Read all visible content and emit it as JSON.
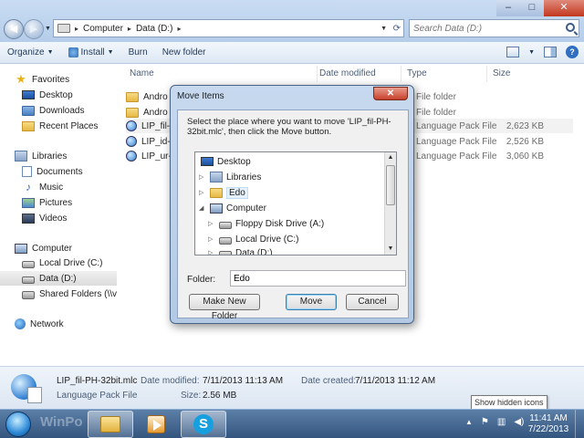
{
  "window": {
    "address_crumbs": [
      "Computer",
      "Data (D:)"
    ],
    "search_placeholder": "Search Data (D:)",
    "min_label": "–",
    "max_label": "□",
    "close_label": "✕"
  },
  "toolbar": {
    "organize": "Organize",
    "install": "Install",
    "burn": "Burn",
    "new_folder": "New folder"
  },
  "sidebar": {
    "favorites_header": "Favorites",
    "favorites": [
      "Desktop",
      "Downloads",
      "Recent Places"
    ],
    "libraries_header": "Libraries",
    "libraries": [
      "Documents",
      "Music",
      "Pictures",
      "Videos"
    ],
    "computer_header": "Computer",
    "drives": [
      "Local Drive (C:)",
      "Data (D:)",
      "Shared Folders (\\\\vn"
    ],
    "network": "Network"
  },
  "files": {
    "columns": {
      "name": "Name",
      "date": "Date modified",
      "type": "Type",
      "size": "Size"
    },
    "rows": [
      {
        "name": "Andro",
        "type": "File folder",
        "size": ""
      },
      {
        "name": "Andro",
        "type": "File folder",
        "size": ""
      },
      {
        "name": "LIP_fil-",
        "type": "Language Pack File",
        "size": "2,623 KB"
      },
      {
        "name": "LIP_id-",
        "type": "Language Pack File",
        "size": "2,526 KB"
      },
      {
        "name": "LIP_ur-",
        "type": "Language Pack File",
        "size": "3,060 KB"
      }
    ]
  },
  "details": {
    "name": "LIP_fil-PH-32bit.mlc",
    "type": "Language Pack File",
    "date_modified_label": "Date modified:",
    "date_modified": "7/11/2013 11:13 AM",
    "date_created_label": "Date created:",
    "date_created": "7/11/2013 11:12 AM",
    "size_label": "Size:",
    "size": "2.56 MB"
  },
  "tooltip": "Show hidden icons",
  "taskbar": {
    "watermark": "WinPo",
    "skype_glyph": "S",
    "time": "11:41 AM",
    "date": "7/22/2013"
  },
  "dialog": {
    "title": "Move Items",
    "message": "Select the place where you want to move 'LIP_fil-PH-32bit.mlc', then click the Move button.",
    "tree": [
      "Desktop",
      "Libraries",
      "Edo",
      "Computer",
      "Floppy Disk Drive (A:)",
      "Local Drive (C:)",
      "Data (D:)"
    ],
    "folder_label": "Folder:",
    "folder_value": "Edo",
    "make_new_folder": "Make New Folder",
    "move": "Move",
    "cancel": "Cancel"
  }
}
